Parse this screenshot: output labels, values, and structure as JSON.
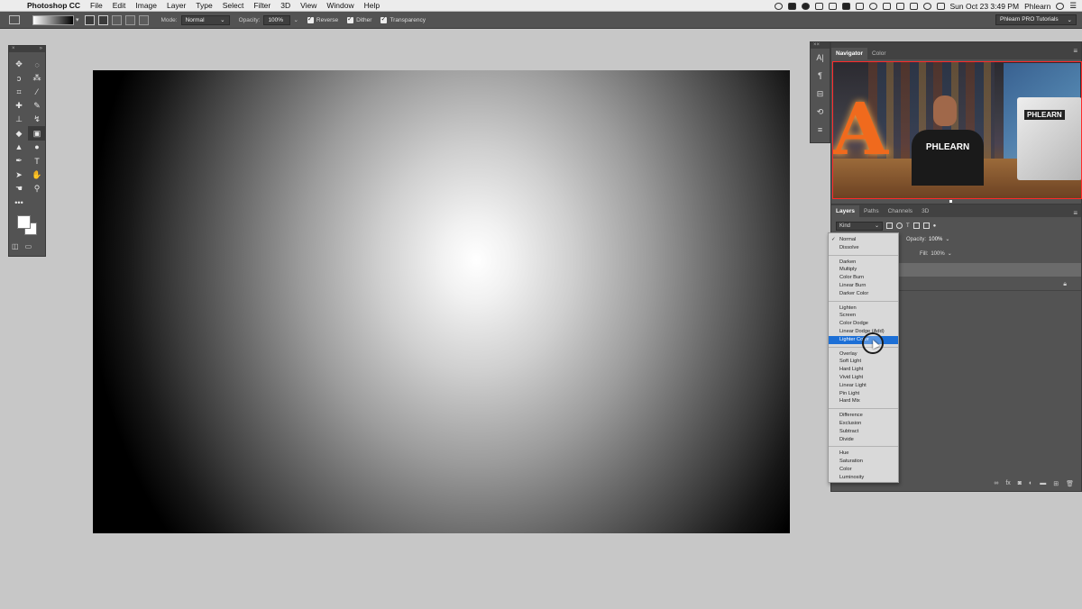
{
  "menubar": {
    "app": "Photoshop CC",
    "items": [
      "File",
      "Edit",
      "Image",
      "Layer",
      "Type",
      "Select",
      "Filter",
      "3D",
      "View",
      "Window",
      "Help"
    ],
    "clock": "Sun Oct 23  3:49 PM",
    "user": "Phlearn"
  },
  "options": {
    "mode_label": "Mode:",
    "mode_value": "Normal",
    "opacity_label": "Opacity:",
    "opacity_value": "100%",
    "reverse": "Reverse",
    "dither": "Dither",
    "transparency": "Transparency",
    "workspace": "Phlearn PRO Tutorials"
  },
  "navigator": {
    "tabs": [
      "Navigator",
      "Color"
    ],
    "shirt_text": "PHLEARN",
    "monitor_text": "PHLEARN",
    "letter": "A"
  },
  "layers": {
    "tabs": [
      "Layers",
      "Paths",
      "Channels",
      "3D"
    ],
    "kind": "Kind",
    "opacity_label": "Opacity:",
    "opacity_value": "100%",
    "fill_label": "Fill:",
    "fill_value": "100%"
  },
  "blend_menu": {
    "checked": "Normal",
    "highlighted": "Lighter Color",
    "groups": [
      [
        "Normal",
        "Dissolve"
      ],
      [
        "Darken",
        "Multiply",
        "Color Burn",
        "Linear Burn",
        "Darker Color"
      ],
      [
        "Lighten",
        "Screen",
        "Color Dodge",
        "Linear Dodge (Add)",
        "Lighter Color"
      ],
      [
        "Overlay",
        "Soft Light",
        "Hard Light",
        "Vivid Light",
        "Linear Light",
        "Pin Light",
        "Hard Mix"
      ],
      [
        "Difference",
        "Exclusion",
        "Subtract",
        "Divide"
      ],
      [
        "Hue",
        "Saturation",
        "Color",
        "Luminosity"
      ]
    ]
  },
  "colors": {
    "panel": "#535353",
    "canvas_center": "#ffffff",
    "canvas_edge": "#000000",
    "highlight": "#1c6fd6"
  }
}
